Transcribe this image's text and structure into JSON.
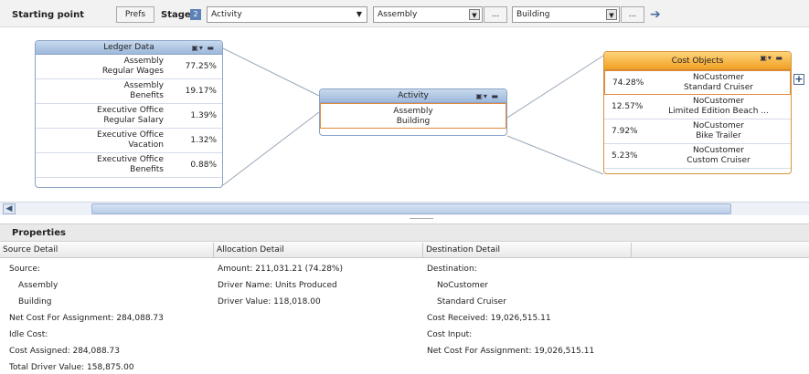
{
  "toolbar": {
    "title": "Starting point",
    "prefs_label": "Prefs",
    "stage_label": "Stage",
    "stage_number": "2",
    "stage_value": "Activity",
    "filter1_value": "Assembly",
    "filter2_value": "Building",
    "more_label": "..."
  },
  "ledger": {
    "title": "Ledger Data",
    "rows": [
      {
        "line1": "Assembly",
        "line2": "Regular Wages",
        "pct": "77.25%"
      },
      {
        "line1": "Assembly",
        "line2": "Benefits",
        "pct": "19.17%"
      },
      {
        "line1": "Executive Office",
        "line2": "Regular Salary",
        "pct": "1.39%"
      },
      {
        "line1": "Executive Office",
        "line2": "Vacation",
        "pct": "1.32%"
      },
      {
        "line1": "Executive Office",
        "line2": "Benefits",
        "pct": "0.88%"
      }
    ]
  },
  "activity": {
    "title": "Activity",
    "line1": "Assembly",
    "line2": "Building"
  },
  "cost_objects": {
    "title": "Cost Objects",
    "rows": [
      {
        "pct": "74.28%",
        "line1": "NoCustomer",
        "line2": "Standard Cruiser"
      },
      {
        "pct": "12.57%",
        "line1": "NoCustomer",
        "line2": "Limited Edition Beach ..."
      },
      {
        "pct": "7.92%",
        "line1": "NoCustomer",
        "line2": "Bike Trailer"
      },
      {
        "pct": "5.23%",
        "line1": "NoCustomer",
        "line2": "Custom Cruiser"
      }
    ]
  },
  "properties": {
    "title": "Properties",
    "columns": [
      "Source Detail",
      "Allocation Detail",
      "Destination Detail"
    ],
    "source": [
      "Source:",
      "Assembly",
      "Building",
      "Net Cost For Assignment: 284,088.73",
      "Idle Cost:",
      "Cost Assigned: 284,088.73",
      "Total Driver Value: 158,875.00"
    ],
    "allocation": [
      "Amount: 211,031.21 (74.28%)",
      "Driver Name: Units Produced",
      "Driver Value: 118,018.00"
    ],
    "destination": [
      "Destination:",
      "NoCustomer",
      "Standard Cruiser",
      "Cost Received: 19,026,515.11",
      "Cost Input:",
      "Net Cost For Assignment: 19,026,515.11"
    ]
  }
}
